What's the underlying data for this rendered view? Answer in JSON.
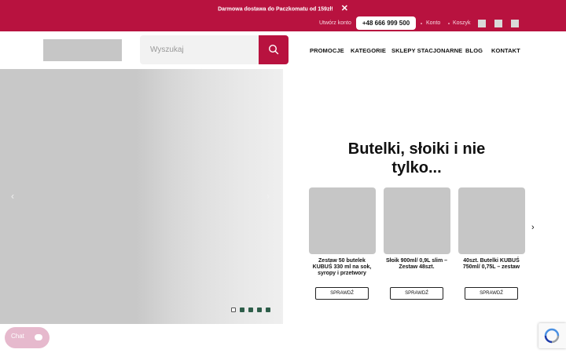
{
  "topbar": {
    "promo_text": "Darmowa dostawa do Paczkomatu od 159zł!",
    "close_glyph": "✕",
    "create_account": "Utwórz konto",
    "phone": "+48 666 999 500",
    "account": "Konto",
    "cart": "Koszyk"
  },
  "header": {
    "search_placeholder": "Wyszukaj",
    "nav": [
      "PROMOCJE",
      "KATEGORIE",
      "SKLEPY STACJONARNE",
      "BLOG",
      "KONTAKT"
    ]
  },
  "hero": {
    "prev_glyph": "‹",
    "next_glyph": "›",
    "slides_count": 5,
    "active_slide": 1,
    "title_line1": "Butelki, słoiki i nie",
    "title_line2": "tylko...",
    "carousel_next_glyph": "›",
    "products": [
      {
        "name_line1": "Zestaw 50 butelek",
        "name_line2": "KUBUŚ 330 ml na sok,",
        "name_line3": "syropy i przetwory",
        "button": "SPRAWDŹ"
      },
      {
        "name_line1": "Słoik 900ml/ 0,9L slim –",
        "name_line2": "Zestaw 48szt.",
        "name_line3": "",
        "button": "SPRAWDŹ"
      },
      {
        "name_line1": "40szt. Butelki KUBUŚ",
        "name_line2": "750ml/ 0,75L – zestaw",
        "name_line3": "",
        "button": "SPRAWDŹ"
      }
    ]
  },
  "chat": {
    "label": "Chat"
  },
  "colors": {
    "brand": "#b8123f",
    "dot_inactive": "#2e5e4a",
    "chat": "#e6b9cd"
  },
  "icons": [
    "search-icon",
    "close-icon",
    "chevron-left-icon",
    "chevron-right-icon",
    "chat-bubble-icon",
    "recaptcha-icon"
  ]
}
